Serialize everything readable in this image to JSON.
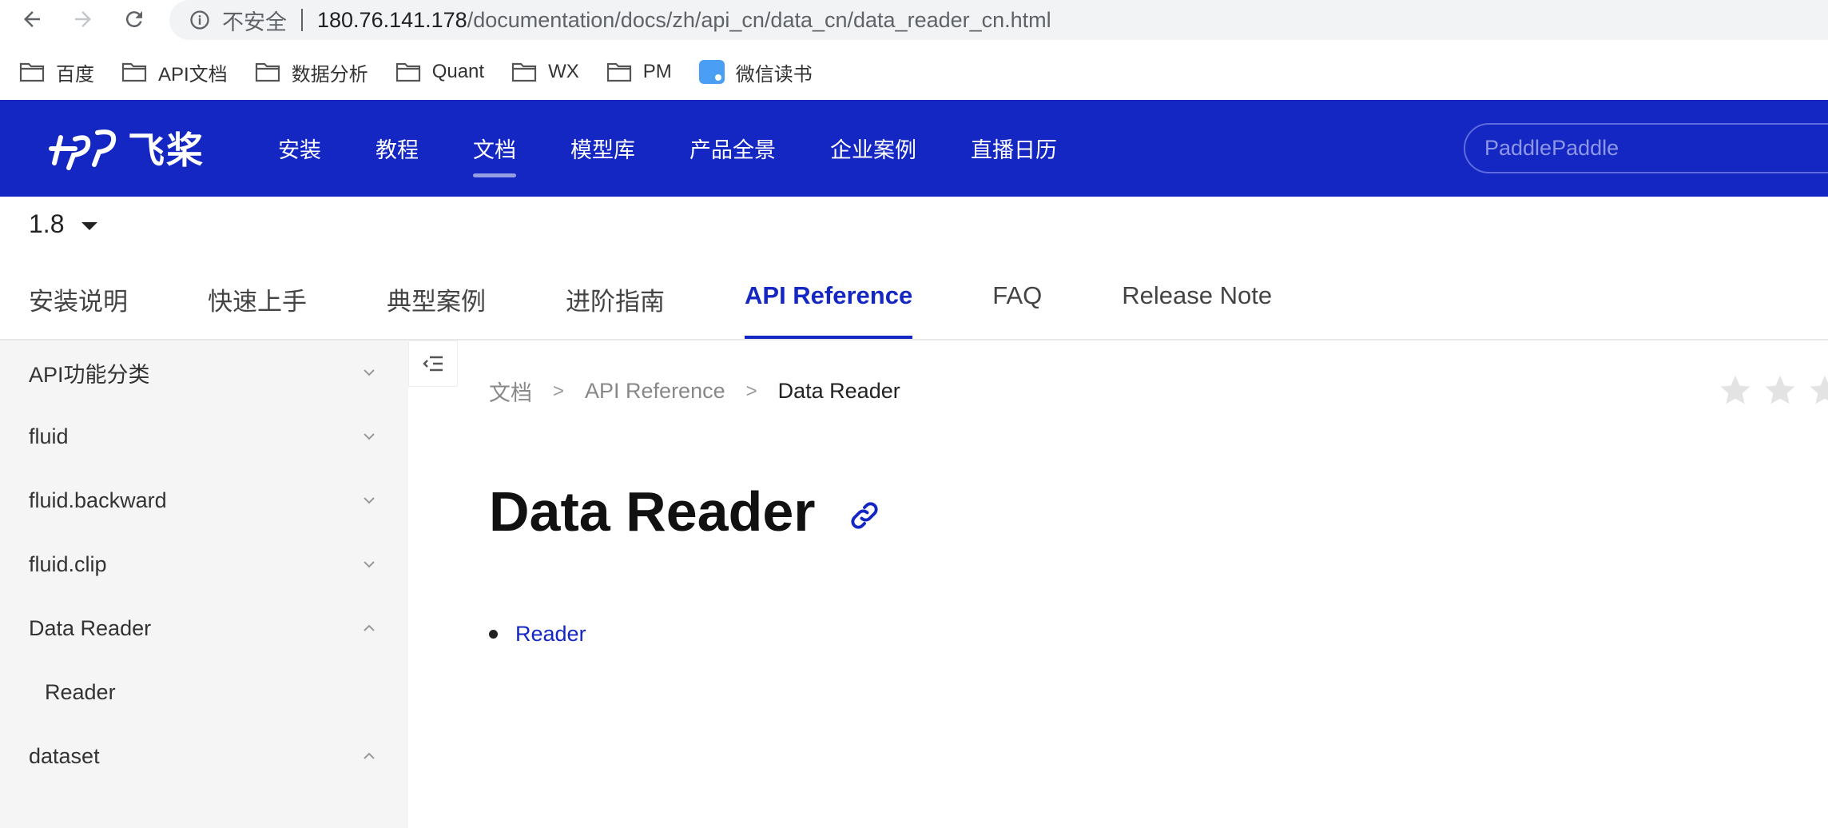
{
  "browser": {
    "insecure_label": "不安全",
    "url_host": "180.76.141.178",
    "url_path": "/documentation/docs/zh/api_cn/data_cn/data_reader_cn.html",
    "bookmarks": [
      "百度",
      "API文档",
      "数据分析",
      "Quant",
      "WX",
      "PM",
      "微信读书"
    ]
  },
  "header": {
    "logo_text": "飞桨",
    "nav": [
      "安装",
      "教程",
      "文档",
      "模型库",
      "产品全景",
      "企业案例",
      "直播日历"
    ],
    "active_nav": "文档",
    "search_placeholder": "PaddlePaddle",
    "brand_color": "#1527c2"
  },
  "version": "1.8",
  "doc_tabs": [
    "安装说明",
    "快速上手",
    "典型案例",
    "进阶指南",
    "API Reference",
    "FAQ",
    "Release Note"
  ],
  "active_doc_tab": "API Reference",
  "sidebar": {
    "items": [
      {
        "label": "API功能分类",
        "chevron": "down"
      },
      {
        "label": "fluid",
        "chevron": "down"
      },
      {
        "label": "fluid.backward",
        "chevron": "down"
      },
      {
        "label": "fluid.clip",
        "chevron": "down"
      },
      {
        "label": "Data Reader",
        "chevron": "up"
      },
      {
        "label": "Reader",
        "chevron": "none"
      },
      {
        "label": "dataset",
        "chevron": "up"
      }
    ]
  },
  "breadcrumb": [
    "文档",
    "API Reference",
    "Data Reader"
  ],
  "page_title": "Data Reader",
  "toc_links": [
    "Reader"
  ]
}
